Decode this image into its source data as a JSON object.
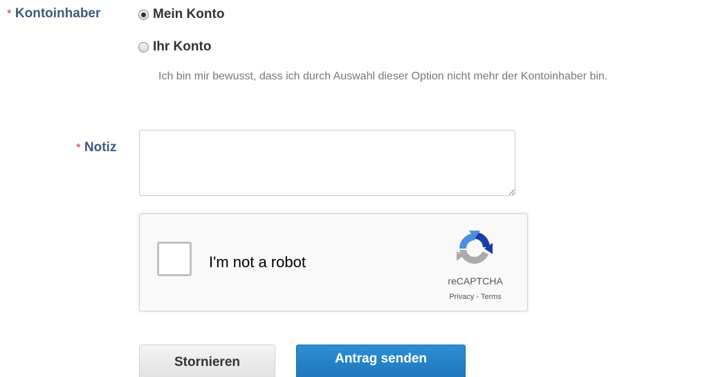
{
  "form": {
    "required_marker": "*",
    "owner_label": "Kontoinhaber",
    "owner_options": [
      {
        "label": "Mein Konto",
        "checked": true
      },
      {
        "label": "Ihr Konto",
        "checked": false
      }
    ],
    "owner_hint": "Ich bin mir bewusst, dass ich durch Auswahl dieser Option nicht mehr der Kontoinhaber bin.",
    "note_label": "Notiz",
    "note_value": "",
    "colors": {
      "label": "#3f5a79",
      "required": "#e0312c",
      "primary_button": "#2382c8"
    }
  },
  "recaptcha": {
    "label": "I'm not a robot",
    "checked": false,
    "brand": "reCAPTCHA",
    "privacy": "Privacy",
    "separator": " - ",
    "terms": "Terms"
  },
  "buttons": {
    "cancel_label": "Stornieren",
    "submit_label": "Antrag senden"
  }
}
